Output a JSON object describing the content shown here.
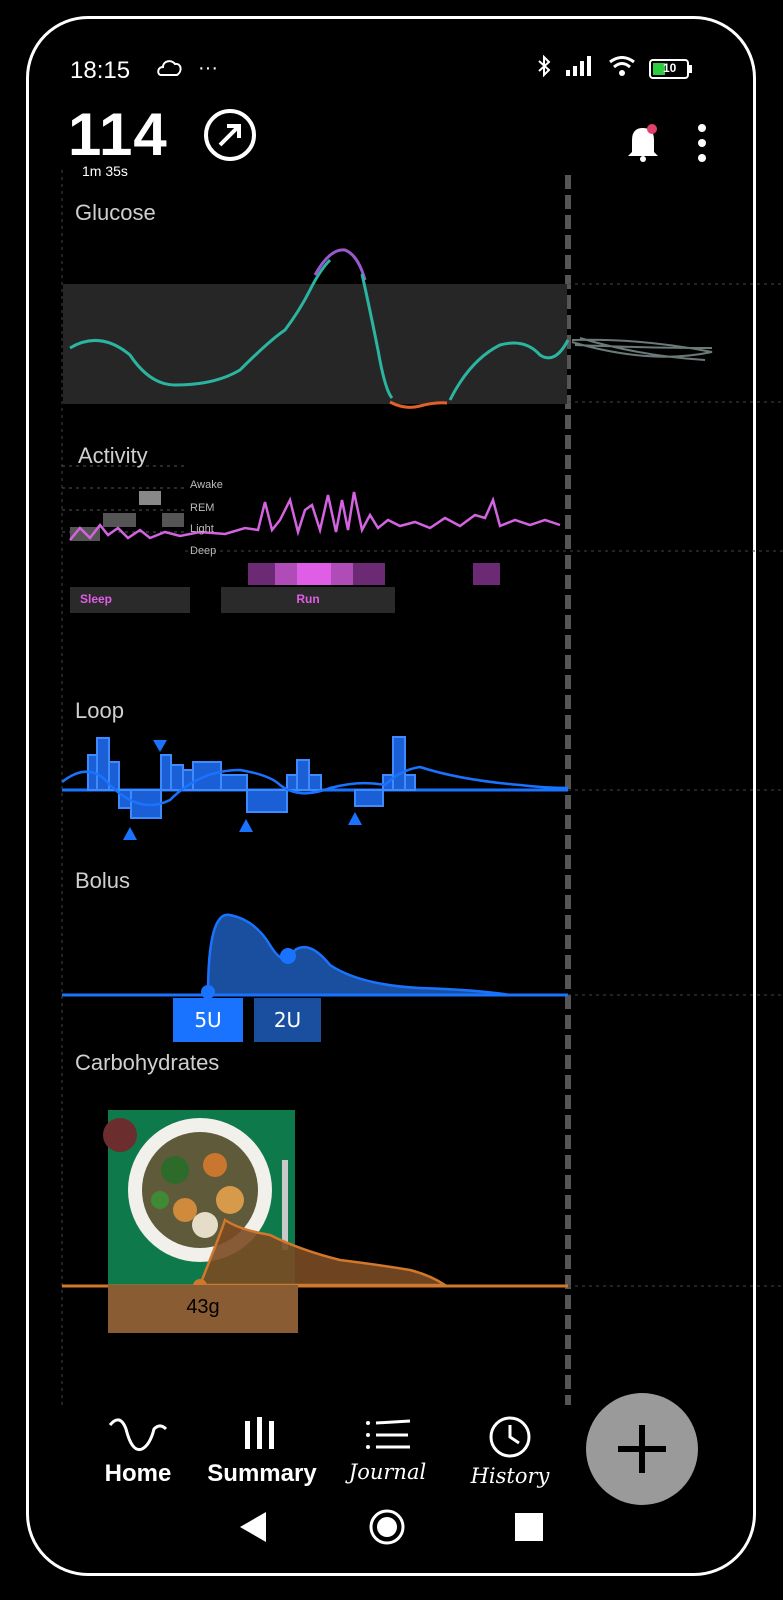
{
  "status_bar": {
    "time": "18:15",
    "dots": "···",
    "battery": "10",
    "icons": [
      "bluetooth-icon",
      "signal-icon",
      "wifi-icon",
      "battery-icon"
    ]
  },
  "header": {
    "glucose_value": "114",
    "glucose_age": "1m 35s",
    "trend_icon": "arrow-up-right-icon",
    "notification_icon": "bell-icon",
    "menu_icon": "more-vertical-icon"
  },
  "sections": {
    "glucose": {
      "label": "Glucose"
    },
    "activity": {
      "label": "Activity",
      "sleep_stages": [
        "Awake",
        "REM",
        "Light",
        "Deep"
      ],
      "events": [
        "Sleep",
        "Run"
      ]
    },
    "loop": {
      "label": "Loop"
    },
    "bolus": {
      "label": "Bolus",
      "doses": [
        "5U",
        "2U"
      ]
    },
    "carbohydrates": {
      "label": "Carbohydrates",
      "amount": "43g"
    }
  },
  "nav": {
    "items": [
      {
        "label": "Home",
        "icon": "wave-icon"
      },
      {
        "label": "Summary",
        "icon": "bars-icon"
      },
      {
        "label": "Journal",
        "icon": "list-icon"
      },
      {
        "label": "History",
        "icon": "clock-icon"
      }
    ],
    "fab_icon": "plus-icon"
  },
  "colors": {
    "glucose_in_range": "#2bb5a0",
    "glucose_high": "#9b59d0",
    "glucose_low": "#e0622a",
    "activity": "#d463e0",
    "insulin": "#1a73ff",
    "carbs": "#8a5c33",
    "fab": "#9a9a9a"
  }
}
